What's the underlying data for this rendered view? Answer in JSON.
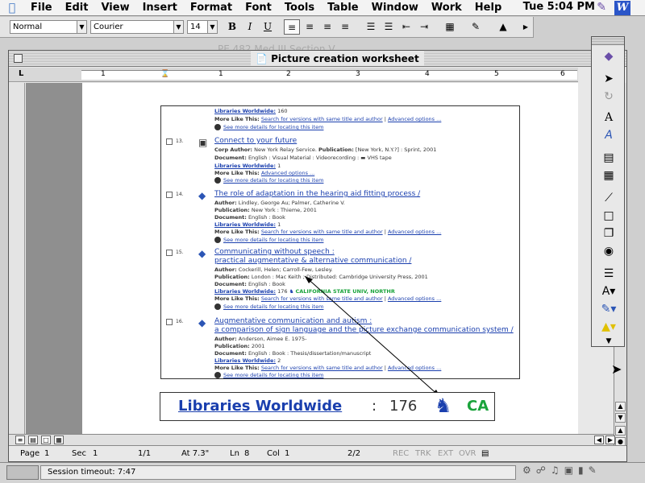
{
  "menubar": {
    "items": [
      "File",
      "Edit",
      "View",
      "Insert",
      "Format",
      "Font",
      "Tools",
      "Table",
      "Window",
      "Work",
      "Help"
    ],
    "clock": "Tue 5:04 PM",
    "app_icon": "W"
  },
  "format_toolbar": {
    "style": "Normal",
    "font": "Courier",
    "size": "14",
    "bold": "B",
    "italic": "I",
    "underline": "U"
  },
  "background_window_title": "PE 482 Med III Section V",
  "document_window": {
    "title": "Picture creation worksheet"
  },
  "ruler": {
    "marks": [
      "1",
      "1",
      "2",
      "3",
      "4",
      "5",
      "6"
    ]
  },
  "screenshot": {
    "entries": [
      {
        "number": "",
        "lines": [
          {
            "label": "Libraries Worldwide:",
            "value": "160"
          },
          {
            "label": "More Like This:",
            "links": [
              "Search for versions with same title and author",
              "Advanced options ..."
            ]
          },
          {
            "see": "See more details for locating this item"
          }
        ]
      },
      {
        "number": "13.",
        "icon": "camera-icon",
        "title": "Connect to your future",
        "author_label": "Corp Author:",
        "author": "New York Relay Service.",
        "pub_label": "Publication:",
        "pub": "[New York, N.Y.?] : Sprint, 2001",
        "doc_label": "Document:",
        "doc": "English : Visual Material : Videorecording :",
        "doc_suffix": "VHS tape",
        "lw_label": "Libraries Worldwide:",
        "lw": "1",
        "mlt_label": "More Like This:",
        "mlt_links": [
          "Advanced options ..."
        ],
        "see": "See more details for locating this item"
      },
      {
        "number": "14.",
        "icon": "book-icon",
        "title": "The role of adaptation in the hearing aid fitting process /",
        "author_label": "Author:",
        "author": "Lindley, George Au; Palmer, Catherine V.",
        "pub_label": "Publication:",
        "pub": "New York : Thieme, 2001",
        "doc_label": "Document:",
        "doc": "English : Book",
        "lw_label": "Libraries Worldwide:",
        "lw": "1",
        "mlt_label": "More Like This:",
        "mlt_links": [
          "Search for versions with same title and author",
          "Advanced options ..."
        ],
        "see": "See more details for locating this item"
      },
      {
        "number": "15.",
        "icon": "book-icon",
        "title": "Communicating without speech :",
        "title2": "practical augmentative & alternative communication /",
        "author_label": "Author:",
        "author": "Cockerill, Helen; Carroll-Few, Lesley.",
        "pub_label": "Publication:",
        "pub": "London : Mac Keith ; Distributed: Cambridge University Press, 2001",
        "doc_label": "Document:",
        "doc": "English : Book",
        "lw_label": "Libraries Worldwide:",
        "lw": "176",
        "lw_extra": "CALIFORNIA STATE UNIV, NORTHR",
        "mlt_label": "More Like This:",
        "mlt_links": [
          "Search for versions with same title and author",
          "Advanced options ..."
        ],
        "see": "See more details for locating this item"
      },
      {
        "number": "16.",
        "icon": "book-icon",
        "title": "Augmentative communication and autism :",
        "title2": "a comparison of sign language and the picture exchange communication system /",
        "author_label": "Author:",
        "author": "Anderson, Aimee E. 1975-",
        "pub_label": "Publication:",
        "pub": "2001",
        "doc_label": "Document:",
        "doc": "English : Book : Thesis/dissertation/manuscript",
        "lw_label": "Libraries Worldwide:",
        "lw": "2",
        "mlt_label": "More Like This:",
        "mlt_links": [
          "Search for versions with same title and author",
          "Advanced options ..."
        ],
        "see": "See more details for locating this item"
      }
    ]
  },
  "zoomed": {
    "label": "Libraries Worldwide",
    "colon": ":",
    "count": "176",
    "ca": "CA"
  },
  "statusbar": {
    "page": "Page",
    "page_num": "1",
    "sec": "Sec",
    "sec_num": "1",
    "pages": "1/1",
    "at": "At 7.3\"",
    "ln": "Ln",
    "ln_num": "8",
    "col": "Col",
    "col_num": "1",
    "count": "2/2",
    "rec": "REC",
    "trk": "TRK",
    "ext": "EXT",
    "ovr": "OVR"
  },
  "taskbar": {
    "message": "Session timeout: 7:47"
  }
}
